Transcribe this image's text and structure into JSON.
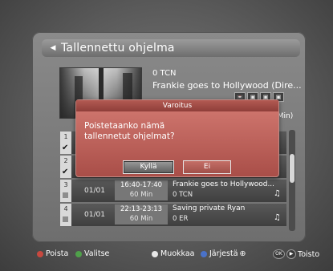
{
  "header": {
    "title": "Tallennettu ohjelma"
  },
  "preview": {
    "channel": "0 TCN",
    "program": "Frankie goes to Hollywood (Dire...",
    "icons": [
      "📼",
      "▣",
      "▣",
      "▣"
    ],
    "duration_peek": "0Min)"
  },
  "dialog": {
    "title": "Varoitus",
    "message": "Poistetaanko nämä tallennetut ohjelmat?",
    "yes": "Kyllä",
    "no": "Ei"
  },
  "rows": [
    {
      "num": "1",
      "checked": true
    },
    {
      "num": "2",
      "checked": true
    },
    {
      "num": "3",
      "date": "01/01",
      "time": "16:40-17:40",
      "duration": "60 Min",
      "title": "Frankie goes to Hollywood...",
      "channel": "0 TCN",
      "note": "♫"
    },
    {
      "num": "4",
      "date": "01/01",
      "time": "22:13-23:13",
      "duration": "60 Min",
      "title": "Saving private Ryan",
      "channel": "0 ER",
      "note": "♫"
    }
  ],
  "row2_note": "♫",
  "helpbar": {
    "delete": "Poista",
    "select": "Valitse",
    "edit": "Muokkaa",
    "sort": "Järjestä",
    "play": "Toisto",
    "colors": {
      "red": "#c7483f",
      "green": "#4fa14a",
      "yellow": "#d9c64a",
      "blue": "#4a72c9",
      "white": "#e8e8e8"
    }
  }
}
